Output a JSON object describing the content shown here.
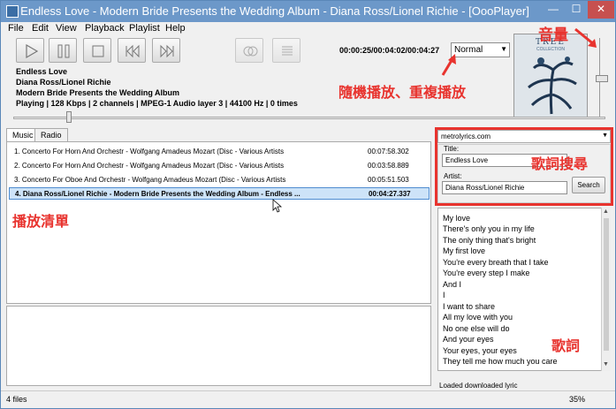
{
  "window": {
    "title": "Endless Love - Modern Bride Presents the Wedding Album - Diana Ross/Lionel Richie - [OooPlayer]",
    "min": "—",
    "max": "☐",
    "close": "✕"
  },
  "menu": [
    "File",
    "Edit",
    "View",
    "Playback",
    "Playlist",
    "Help"
  ],
  "controls": {
    "time": "00:00:25/00:04:02/00:04:27",
    "mode": "Normal",
    "seek_fraction": 0.09,
    "volume_fraction": 0.55
  },
  "album_art": {
    "title": "TREE",
    "subtitle": "COLLECTION"
  },
  "now_playing": {
    "title": "Endless Love",
    "artist": "Diana Ross/Lionel Richie",
    "album": "Modern Bride Presents the Wedding Album",
    "status": "Playing | 128 Kbps | 2 channels | MPEG-1 Audio layer 3 | 44100 Hz | 0 times"
  },
  "tabs": [
    "Music",
    "Radio"
  ],
  "playlist": [
    {
      "title": "1. Concerto For Horn And Orchestr - Wolfgang Amadeus Mozart (Disc - Various Artists",
      "duration": "00:07:58.302"
    },
    {
      "title": "2. Concerto For Horn And Orchestr - Wolfgang Amadeus Mozart (Disc - Various Artists",
      "duration": "00:03:58.889"
    },
    {
      "title": "3. Concerto For Oboe And Orchestr - Wolfgang Amadeus Mozart (Disc - Various Artists",
      "duration": "00:05:51.503"
    },
    {
      "title": "4. Diana Ross/Lionel Richie - Modern Bride Presents the Wedding Album - Endless ...",
      "duration": "00:04:27.337"
    }
  ],
  "lyrics_search": {
    "site": "metrolyrics.com",
    "title_label": "Title:",
    "title_value": "Endless Love",
    "artist_label": "Artist:",
    "artist_value": "Diana Ross/Lionel Richie",
    "search_button": "Search"
  },
  "lyrics": {
    "lines": [
      "My love",
      "There's only you in my life",
      "The only thing that's bright",
      "My first love",
      "You're every breath that I take",
      "You're every step I make",
      "And I",
      "I",
      "I want to share",
      "All my love with you",
      "No one else will do",
      "And your eyes",
      "Your eyes, your eyes",
      "They tell me how much you care"
    ],
    "status": "Loaded downloaded lyric"
  },
  "statusbar": {
    "files": "4 files",
    "zoom": "35%"
  },
  "annotations": {
    "volume": "音量",
    "shuffle_repeat": "隨機播放、重複播放",
    "lyrics_search": "歌詞搜尋",
    "playlist": "播放清單",
    "lyrics": "歌詞"
  },
  "colors": {
    "annotation": "#e8332e",
    "titlebar": "#6c98c9",
    "selection": "#cde3f8"
  }
}
